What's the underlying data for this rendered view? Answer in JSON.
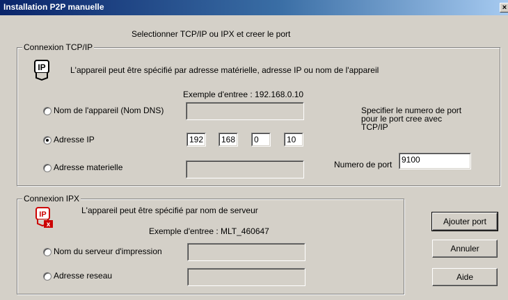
{
  "window": {
    "title": "Installation P2P manuelle",
    "close_glyph": "×"
  },
  "header": {
    "instruction": "Selectionner TCP/IP ou IPX et creer le port"
  },
  "tcpip": {
    "legend": "Connexion TCP/IP",
    "icon": "ip-icon",
    "description": "L'appareil peut être spécifié par adresse matérielle, adresse IP ou nom de l'appareil",
    "example": "Exemple d'entree : 192.168.0.10",
    "options": [
      {
        "label": "Nom de l'appareil (Nom DNS)",
        "selected": false,
        "value": ""
      },
      {
        "label": "Adresse IP",
        "selected": true
      },
      {
        "label": "Adresse materielle",
        "selected": false,
        "value": ""
      }
    ],
    "ip": [
      "192",
      "168",
      "0",
      "10"
    ],
    "port_info": [
      "Specifier le numero de port",
      "pour le port cree avec",
      "TCP/IP"
    ],
    "port_label": "Numero de port",
    "port_value": "9100"
  },
  "ipx": {
    "legend": "Connexion IPX",
    "icon": "ipx-icon",
    "description": "L'appareil peut être spécifié par nom de serveur",
    "example": "Exemple d'entree : MLT_460647",
    "options": [
      {
        "label": "Nom du serveur d'impression",
        "selected": false,
        "value": ""
      },
      {
        "label": "Adresse reseau",
        "selected": false,
        "value": ""
      }
    ]
  },
  "buttons": {
    "add_port": "Ajouter port",
    "cancel": "Annuler",
    "help": "Aide"
  },
  "colors": {
    "face": "#d4d0c8",
    "title_start": "#0a246a",
    "title_end": "#a6caf0",
    "ipx_icon_red": "#cc0000"
  }
}
